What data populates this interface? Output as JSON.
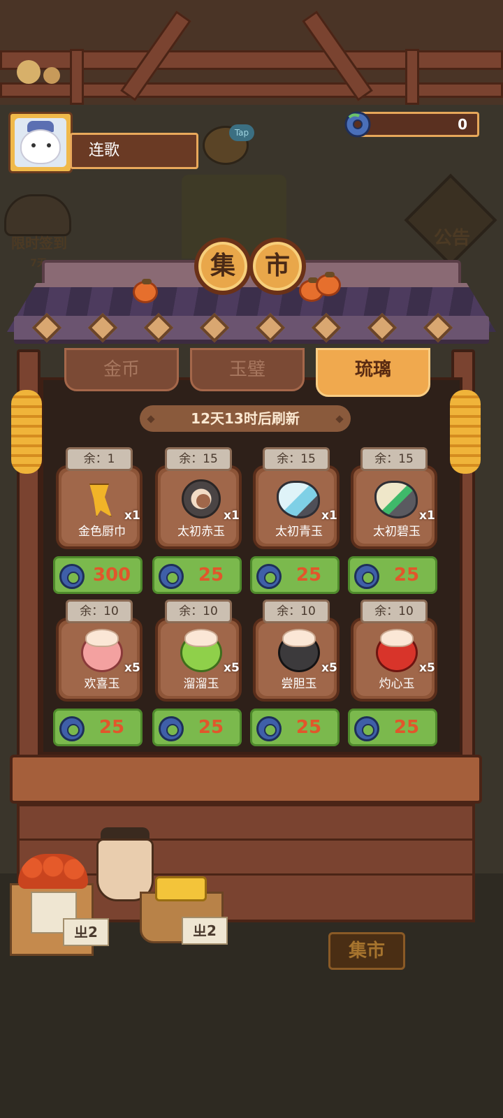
{
  "player": {
    "name": "连歌",
    "avatar_icon": "cat-avatar-icon"
  },
  "currency": {
    "icon": "jade-coin-icon",
    "amount": "0"
  },
  "background": {
    "tap_label": "Tap",
    "signin_label": "限时签到",
    "signin_days": "7天",
    "notice_label": "公告",
    "market_button": "集市"
  },
  "market": {
    "sign_chars": [
      "集",
      "市"
    ],
    "tabs": [
      {
        "label": "金币",
        "active": false
      },
      {
        "label": "玉璧",
        "active": false
      },
      {
        "label": "琉璃",
        "active": true
      }
    ],
    "refresh_text": "12天13时后刷新",
    "items": [
      {
        "stock": "余：1",
        "name": "金色厨巾",
        "qty": "x1",
        "price": "300",
        "icon": "golden-scarf-icon"
      },
      {
        "stock": "余：15",
        "name": "太初赤玉",
        "qty": "x1",
        "price": "25",
        "icon": "red-jade-disc-icon"
      },
      {
        "stock": "余：15",
        "name": "太初青玉",
        "qty": "x1",
        "price": "25",
        "icon": "blue-jade-rock-icon"
      },
      {
        "stock": "余：15",
        "name": "太初碧玉",
        "qty": "x1",
        "price": "25",
        "icon": "green-jade-rock-icon"
      },
      {
        "stock": "余：10",
        "name": "欢喜玉",
        "qty": "x5",
        "price": "25",
        "icon": "pink-swirl-jade-icon"
      },
      {
        "stock": "余：10",
        "name": "溜溜玉",
        "qty": "x5",
        "price": "25",
        "icon": "green-swirl-jade-icon"
      },
      {
        "stock": "余：10",
        "name": "尝胆玉",
        "qty": "x5",
        "price": "25",
        "icon": "black-swirl-jade-icon"
      },
      {
        "stock": "余：10",
        "name": "灼心玉",
        "qty": "x5",
        "price": "25",
        "icon": "red-swirl-jade-icon"
      }
    ]
  },
  "stall_tags": [
    "ㄓ2",
    "ㄓ2"
  ],
  "colors": {
    "price_button": "#7bb94d",
    "price_text": "#e1562b",
    "active_tab": "#f0a94e"
  }
}
